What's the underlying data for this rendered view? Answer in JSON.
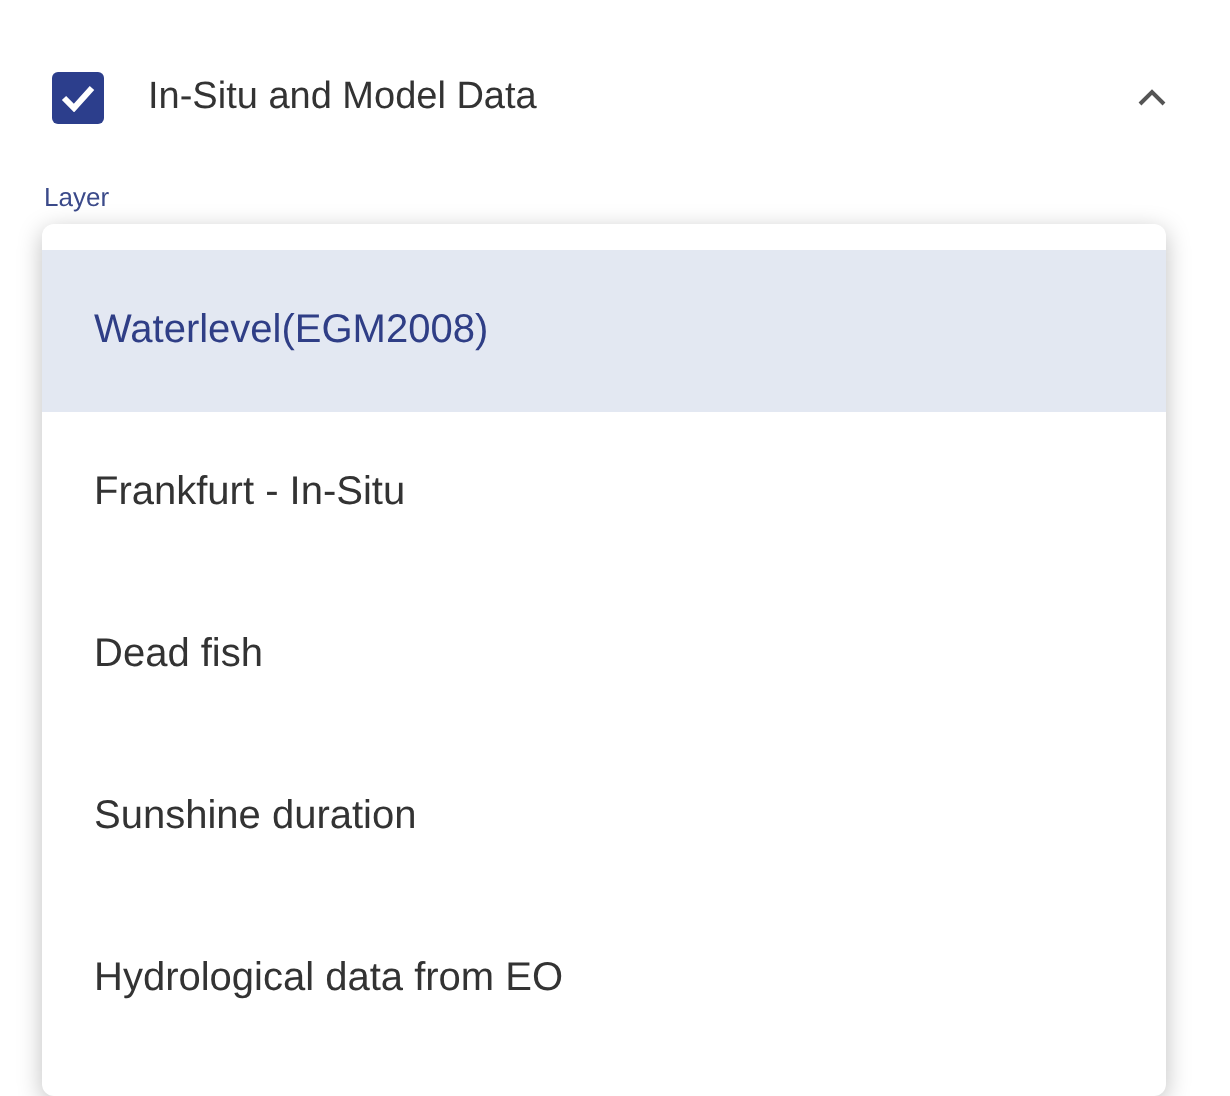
{
  "section": {
    "title": "In-Situ and Model Data",
    "checked": true,
    "expanded": true
  },
  "field": {
    "label": "Layer"
  },
  "menu": {
    "options": [
      {
        "label": "Waterlevel(EGM2008)",
        "selected": true
      },
      {
        "label": "Frankfurt - In-Situ",
        "selected": false
      },
      {
        "label": "Dead fish",
        "selected": false
      },
      {
        "label": "Sunshine duration",
        "selected": false
      },
      {
        "label": "Hydrological data from EO",
        "selected": false
      }
    ]
  }
}
